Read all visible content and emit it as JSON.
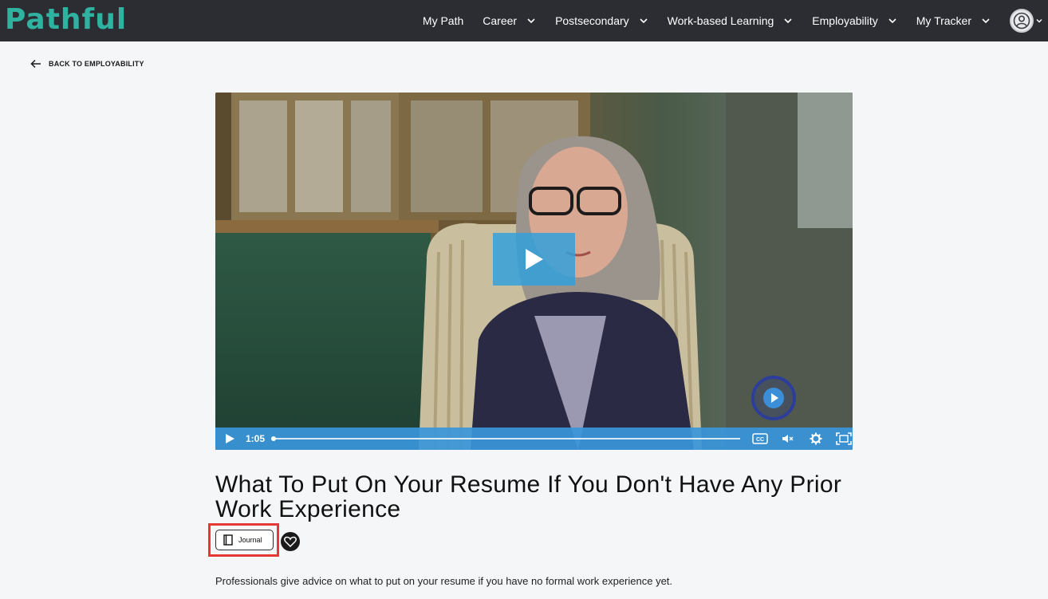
{
  "brand": {
    "logo_text": "Pathful",
    "logo_color": "#2fb3a0"
  },
  "nav": {
    "items": [
      {
        "label": "My Path",
        "has_dropdown": false
      },
      {
        "label": "Career",
        "has_dropdown": true
      },
      {
        "label": "Postsecondary",
        "has_dropdown": true
      },
      {
        "label": "Work-based Learning",
        "has_dropdown": true
      },
      {
        "label": "Employability",
        "has_dropdown": true
      },
      {
        "label": "My Tracker",
        "has_dropdown": true
      }
    ],
    "avatar_icon": "user-circle-icon"
  },
  "back_link": {
    "label": "BACK TO EMPLOYABILITY",
    "icon": "arrow-left-icon"
  },
  "video": {
    "play_icon": "play-icon",
    "current_time": "1:05",
    "progress": 0.0,
    "control_icons": [
      "closed-captions-icon",
      "mute-icon",
      "settings-icon",
      "fullscreen-icon"
    ],
    "accent": "#3a96da"
  },
  "content": {
    "title": "What To Put On Your Resume If You Don't Have Any Prior Work Experience",
    "journal_label": "Journal",
    "description": "Professionals give advice on what to put on your resume if you have no formal work experience yet."
  },
  "colors": {
    "topbar": "#2b2d33",
    "highlight": "#e53935"
  }
}
